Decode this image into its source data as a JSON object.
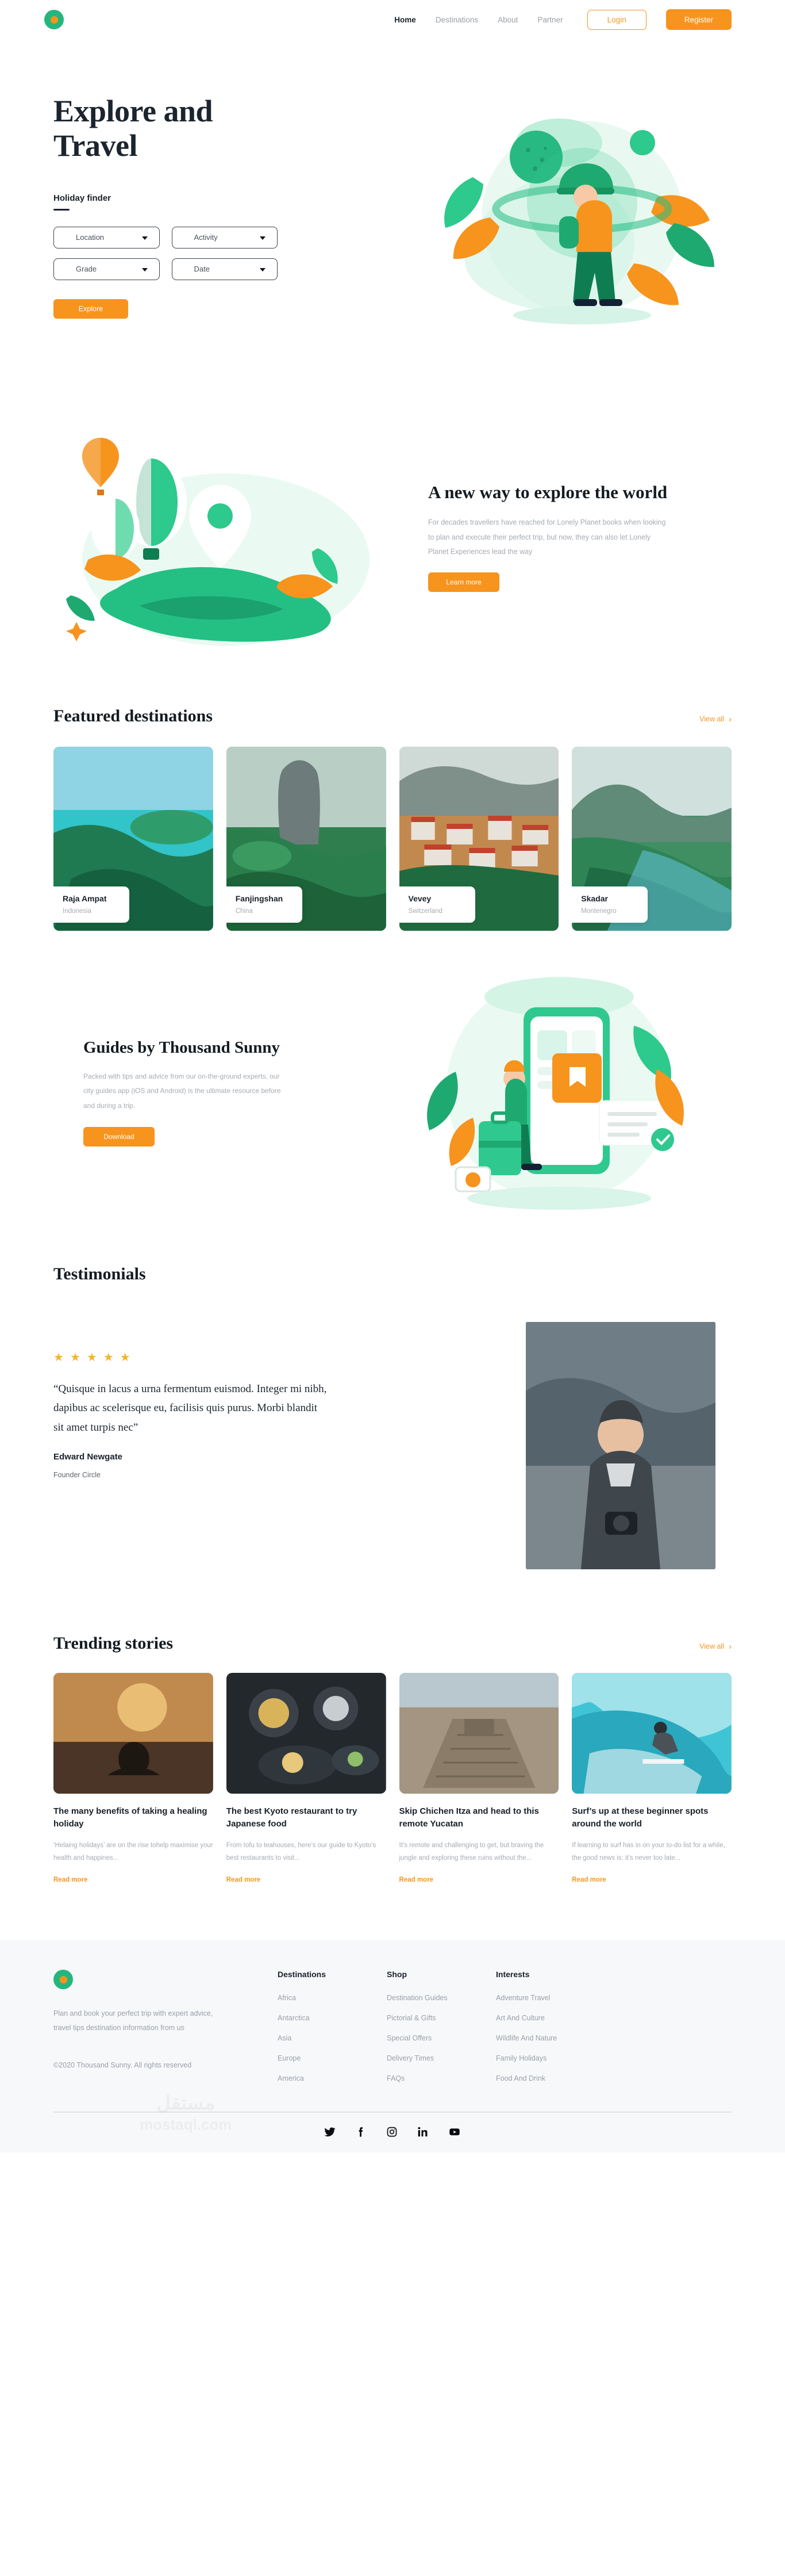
{
  "brand": {
    "name": "Thousand Sunny",
    "logo_colors": {
      "ring": "#25b67e",
      "dot": "#f7941d"
    }
  },
  "nav": {
    "items": [
      {
        "label": "Home",
        "active": true
      },
      {
        "label": "Destinations",
        "active": false
      },
      {
        "label": "About",
        "active": false
      },
      {
        "label": "Partner",
        "active": false
      }
    ],
    "login_label": "Login",
    "register_label": "Register"
  },
  "hero": {
    "title": "Explore and Travel",
    "finder_label": "Holiday finder",
    "fields": [
      {
        "label": "Location"
      },
      {
        "label": "Activity"
      },
      {
        "label": "Grade"
      },
      {
        "label": "Date"
      }
    ],
    "cta_label": "Explore"
  },
  "explore_section": {
    "title": "A new way to explore the world",
    "body": "For decades travellers have reached for Lonely Planet books when looking to plan and execute their perfect trip, but now, they can also let Lonely Planet Experiences lead the way",
    "cta_label": "Learn more"
  },
  "featured": {
    "title": "Featured destinations",
    "view_all_label": "View all",
    "cards": [
      {
        "name": "Raja Ampat",
        "country": "Indonesia"
      },
      {
        "name": "Fanjingshan",
        "country": "China"
      },
      {
        "name": "Vevey",
        "country": "Switzerland"
      },
      {
        "name": "Skadar",
        "country": "Montenegro"
      }
    ]
  },
  "guides": {
    "title": "Guides by Thousand Sunny",
    "body": "Packed with tips and advice from our on-the-ground experts, our city guides app (iOS and Android) is the ultimate resource before and during a trip.",
    "cta_label": "Download"
  },
  "testimonials": {
    "title": "Testimonials",
    "rating": 5,
    "quote": "“Quisque in lacus a urna fermentum euismod. Integer mi nibh, dapibus ac scelerisque eu, facilisis quis purus. Morbi blandit sit amet turpis nec”",
    "author": "Edward Newgate",
    "role": "Founder Circle"
  },
  "stories": {
    "title": "Trending stories",
    "view_all_label": "View all",
    "read_more_label": "Read more",
    "cards": [
      {
        "title": "The many benefits of taking a healing holiday",
        "excerpt": "‘Helaing holidays’ are on the rise tohelp maximise your health and happines..."
      },
      {
        "title": "The best Kyoto restaurant to try Japanese food",
        "excerpt": "From tofu to teahouses, here’s our guide to Kyoto’s best restaurants to visit..."
      },
      {
        "title": "Skip Chichen Itza and head to this remote Yucatan",
        "excerpt": "It’s remote and challenging to get, but braving the jungle and exploring these ruins without the..."
      },
      {
        "title": "Surf’s up at these beginner spots around the world",
        "excerpt": "If learning to surf has in on your to-do list for a while, the good news is: it’s never too late..."
      }
    ]
  },
  "footer": {
    "tagline": "Plan and book your perfect trip with expert advice, travel tips destination information from us",
    "copyright": "©2020 Thousand Sunny. All rights reserved",
    "columns": [
      {
        "heading": "Destinations",
        "links": [
          "Africa",
          "Antarctica",
          "Asia",
          "Europe",
          "America"
        ]
      },
      {
        "heading": "Shop",
        "links": [
          "Destination Guides",
          "Pictorial & Gifts",
          "Special Offers",
          "Delivery Times",
          "FAQs"
        ]
      },
      {
        "heading": "Interests",
        "links": [
          "Adventure Travel",
          "Art And Culture",
          "Wildlife And Nature",
          "Family Holidays",
          "Food And Drink"
        ]
      }
    ],
    "socials": [
      "twitter-icon",
      "facebook-icon",
      "instagram-icon",
      "linkedin-icon",
      "youtube-icon"
    ],
    "watermark": {
      "arabic": "مستقل",
      "domain": "mostaql.com"
    }
  }
}
